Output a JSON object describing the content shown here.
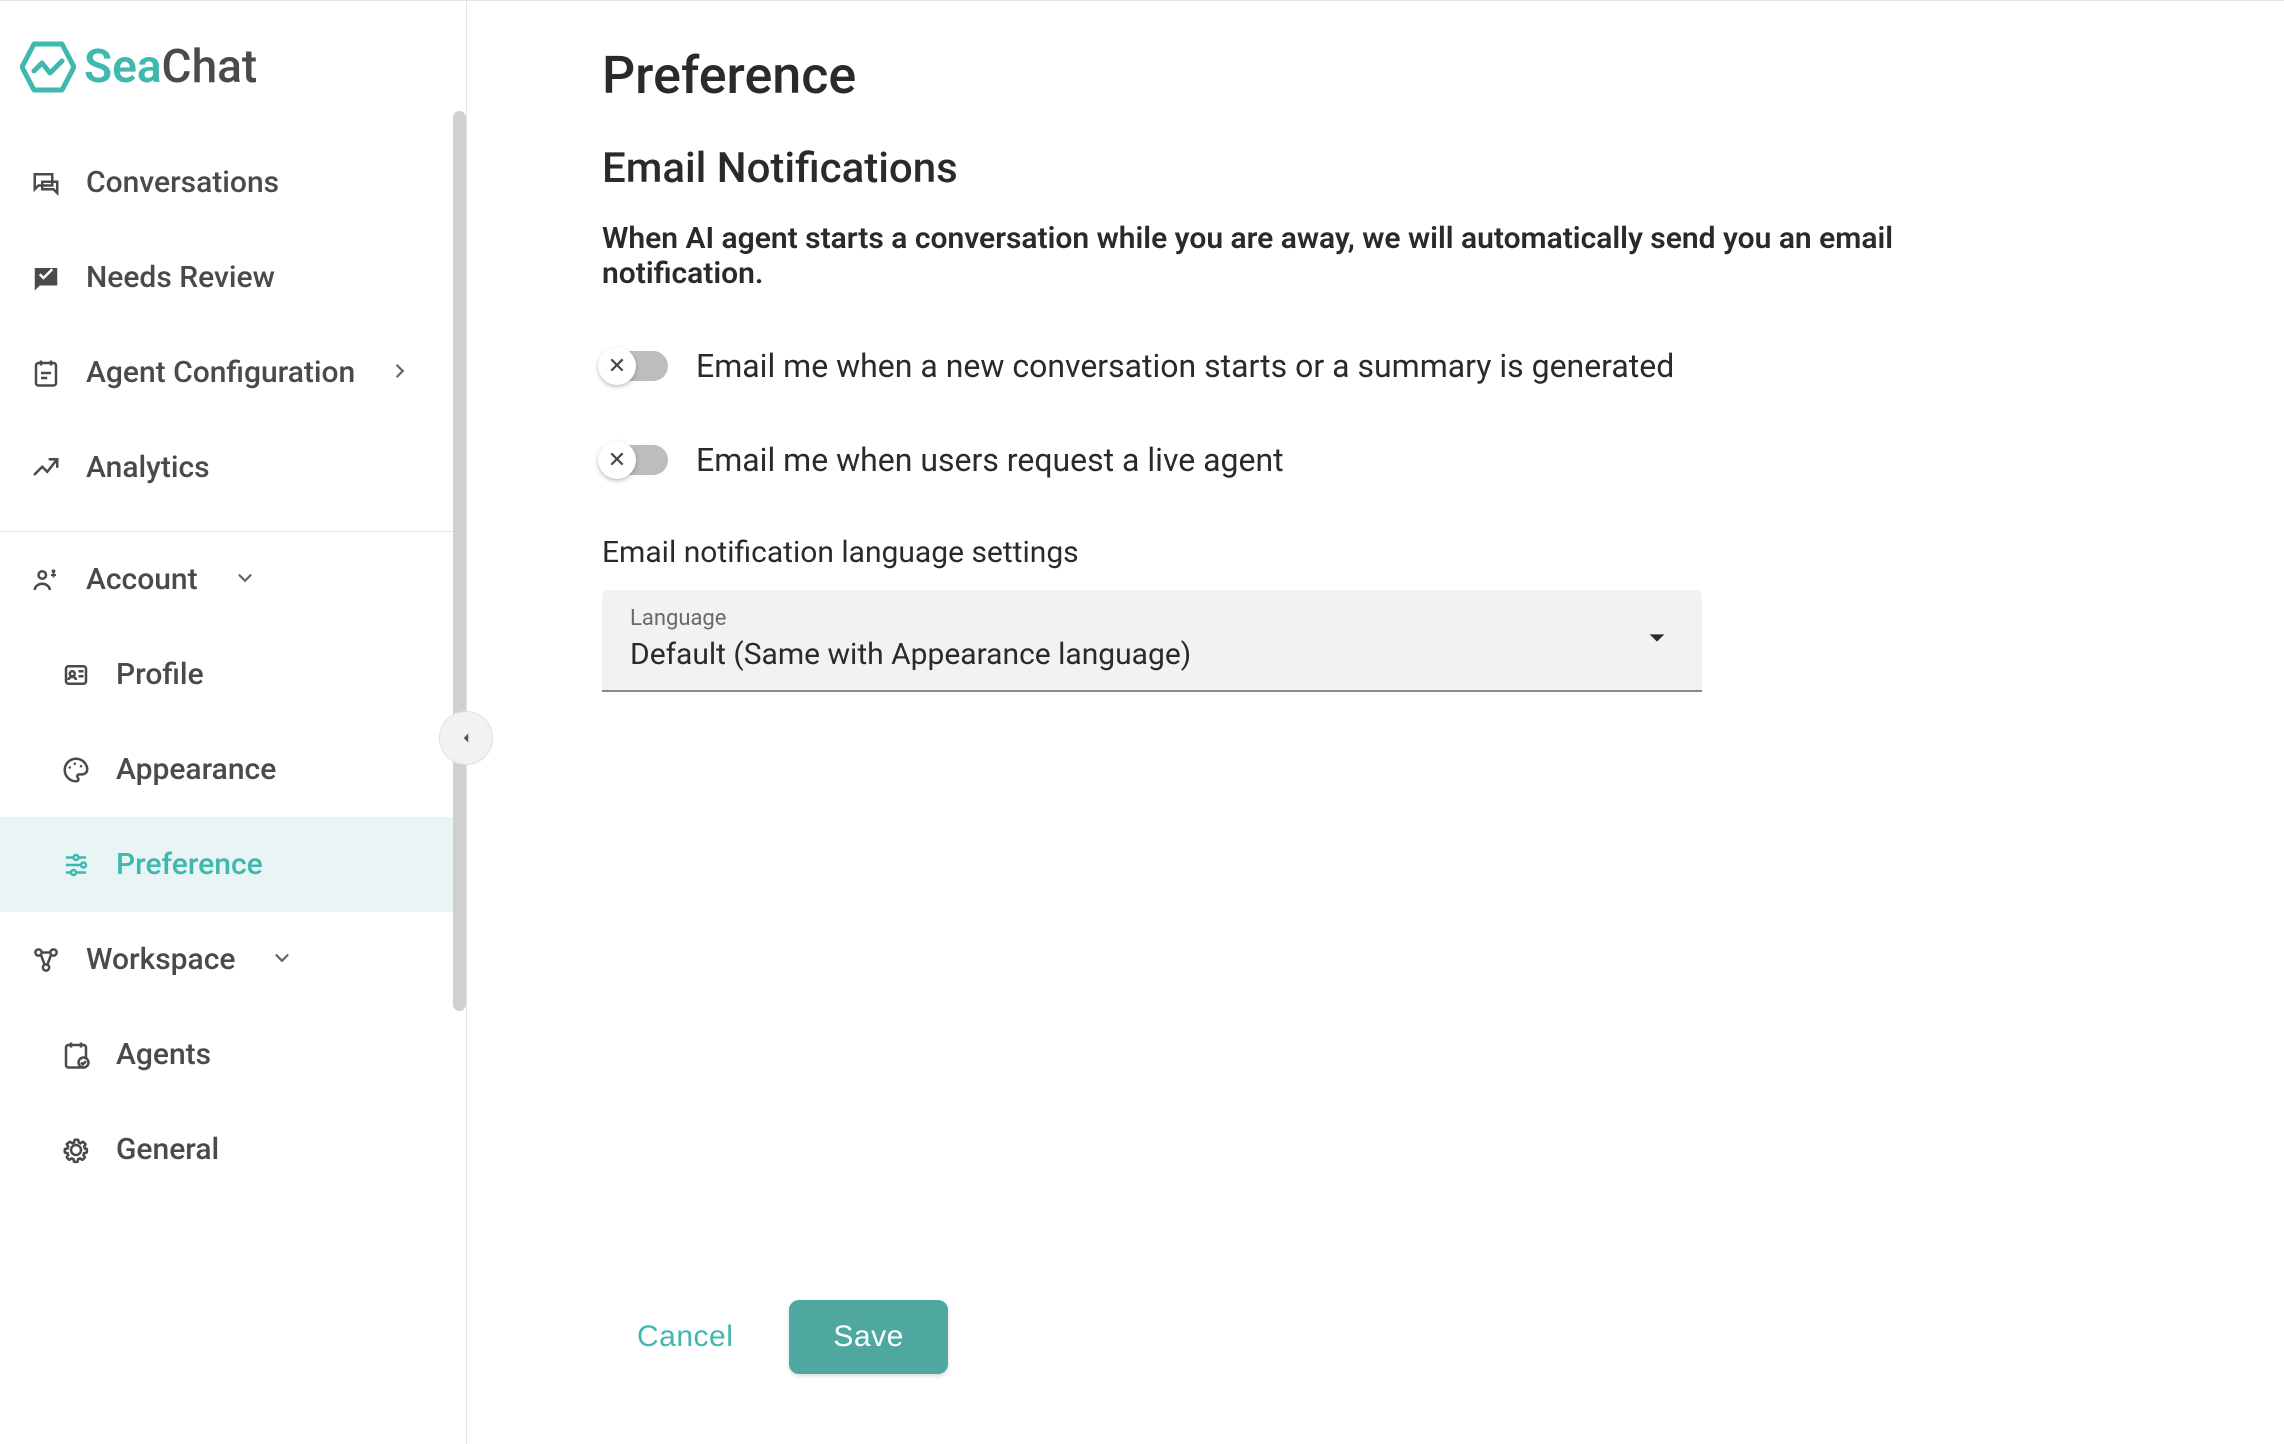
{
  "brand": {
    "name_part1": "Sea",
    "name_part2": "Chat"
  },
  "sidebar": {
    "items": [
      {
        "label": "Conversations",
        "icon": "chat-icon"
      },
      {
        "label": "Needs Review",
        "icon": "review-icon"
      },
      {
        "label": "Agent Configuration",
        "icon": "config-icon",
        "has_chevron": true
      },
      {
        "label": "Analytics",
        "icon": "analytics-icon"
      }
    ],
    "account": {
      "label": "Account",
      "items": [
        {
          "label": "Profile",
          "icon": "profile-icon"
        },
        {
          "label": "Appearance",
          "icon": "appearance-icon"
        },
        {
          "label": "Preference",
          "icon": "preference-icon",
          "active": true
        }
      ]
    },
    "workspace": {
      "label": "Workspace",
      "items": [
        {
          "label": "Agents",
          "icon": "agents-icon"
        },
        {
          "label": "General",
          "icon": "general-icon"
        }
      ]
    }
  },
  "page": {
    "title": "Preference",
    "section_title": "Email Notifications",
    "section_desc": "When AI agent starts a conversation while you are away, we will automatically send you an email notification.",
    "toggles": [
      {
        "label": "Email me when a new conversation starts or a summary is generated",
        "checked": false
      },
      {
        "label": "Email me when users request a live agent",
        "checked": false
      }
    ],
    "language_label": "Email notification language settings",
    "select": {
      "float_label": "Language",
      "value": "Default (Same with Appearance language)"
    },
    "actions": {
      "cancel": "Cancel",
      "save": "Save"
    }
  },
  "colors": {
    "accent": "#3fb8af",
    "save_bg": "#4ea8a0"
  }
}
